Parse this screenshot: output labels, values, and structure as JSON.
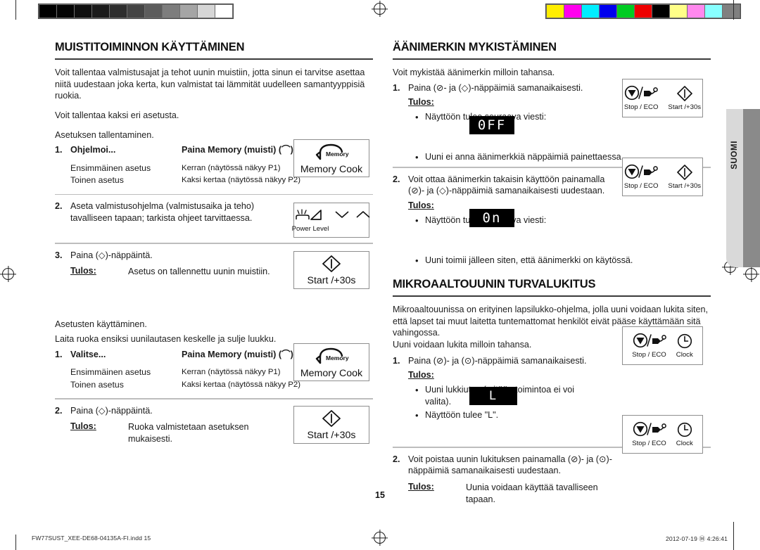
{
  "document": {
    "page_number": "15",
    "language_tab": "SUOMI",
    "footer_file": "FW77SUST_XEE-DE68-04135A-FI.indd   15",
    "footer_date": "2012-07-19   Ⓜ 4:26:41"
  },
  "calibration": {
    "grayscale_patches": [
      "#000000",
      "#050505",
      "#0f0f0f",
      "#1b1b1b",
      "#2e2e2e",
      "#444444",
      "#5c5c5c",
      "#7d7d7d",
      "#a5a5a5",
      "#d6d6d6",
      "#ffffff"
    ],
    "color_patches": [
      "#ffee00",
      "#ff00ee",
      "#00eeff",
      "#0000ee",
      "#00cc22",
      "#ee0000",
      "#000000",
      "#ffff88",
      "#ff88ee",
      "#88ffff",
      "#808080"
    ]
  },
  "left_column": {
    "title": "MUISTITOIMINNON KÄYTTÄMINEN",
    "intro_1": "Voit tallentaa valmistusajat ja tehot uunin muistiin, jotta sinun ei tarvitse asettaa niitä uudestaan joka kerta, kun valmistat tai lämmität uudelleen samantyyppisiä ruokia.",
    "intro_2": "Voit tallentaa kaksi eri asetusta.",
    "subhead_1": "Asetuksen tallentaminen.",
    "store": {
      "step1_num": "1.",
      "head_col1": "Ohjelmoi...",
      "head_col2": "Paina Memory (muisti) (⌒)-näppäintä...",
      "row1_col1": "Ensimmäinen asetus",
      "row1_col2": "Kerran (näytössä näkyy P1)",
      "row2_col1": "Toinen asetus",
      "row2_col2": "Kaksi kertaa (näytössä näkyy P2)",
      "step2_num": "2.",
      "step2_text": "Aseta valmistusohjelma (valmistusaika ja teho) tavalliseen tapaan; tarkista ohjeet tarvittaessa.",
      "step3_num": "3.",
      "step3_text": "Paina (◇)-näppäintä.",
      "step3_result_label": "Tulos:",
      "step3_result_text": "Asetus on tallennettu uunin muistiin."
    },
    "subhead_2": "Asetusten käyttäminen.",
    "use_intro": "Laita ruoka ensiksi uunilautasen keskelle ja sulje luukku.",
    "use": {
      "step1_num": "1.",
      "head_col1": "Valitse...",
      "head_col2": "Paina Memory (muisti) (⌒)-näppäintä...",
      "row1_col1": "Ensimmäinen asetus",
      "row1_col2": "Kerran (näytössä näkyy P1)",
      "row2_col1": "Toinen asetus",
      "row2_col2": "Kaksi kertaa (näytössä näkyy P2)",
      "step2_num": "2.",
      "step2_text": "Paina (◇)-näppäintä.",
      "step2_result_label": "Tulos:",
      "step2_result_text": "Ruoka valmistetaan asetuksen mukaisesti."
    }
  },
  "right_column": {
    "sound": {
      "title": "ÄÄNIMERKIN MYKISTÄMINEN",
      "intro": "Voit mykistää äänimerkin milloin tahansa.",
      "step1_num": "1.",
      "step1_text": "Paina (⊘- ja (◇)-näppäimiä samanaikaisesti.",
      "step1_result_label": "Tulos:",
      "step1_bullet1": "Näyttöön tulee seuraava viesti:",
      "step1_display": "0FF",
      "step1_bullet2": "Uuni ei anna äänimerkkiä näppäimiä painettaessa.",
      "step2_num": "2.",
      "step2_text": "Voit ottaa äänimerkin takaisin käyttöön painamalla (⊘)- ja (◇)-näppäimiä samanaikaisesti uudestaan.",
      "step2_result_label": "Tulos:",
      "step2_bullet1": "Näyttöön tulee seuraava viesti:",
      "step2_display": "0n",
      "step2_bullet2": "Uuni toimii jälleen siten, että äänimerkki on käytössä."
    },
    "lock": {
      "title": "MIKROAALTOUUNIN TURVALUKITUS",
      "intro_1": "Mikroaaltouunissa on erityinen lapsilukko-ohjelma, jolla uuni voidaan lukita siten, että lapset tai muut laitetta tuntemattomat henkilöt eivät pääse käyttämään sitä vahingossa.",
      "intro_2": "Uuni voidaan lukita milloin tahansa.",
      "step1_num": "1.",
      "step1_text": "Paina (⊘)- ja (⊙)-näppäimiä samanaikaisesti.",
      "step1_result_label": "Tulos:",
      "step1_bullet1": "Uuni lukkiutuu (mitään toimintoa ei voi valita).",
      "step1_bullet2": "Näyttöön tulee \"L\".",
      "step1_display": "L",
      "step2_num": "2.",
      "step2_text": "Voit poistaa uunin lukituksen painamalla (⊘)- ja (⊙)-näppäimiä samanaikaisesti uudestaan.",
      "step2_result_label": "Tulos:",
      "step2_result_text": "Uunia voidaan käyttää tavalliseen tapaan."
    }
  },
  "key_boxes": {
    "memory_icon_text": "Memory",
    "memory_label": "Memory Cook",
    "power_level_label": "Power Level",
    "start_label": "Start /+30s",
    "stop_eco_label": "Stop / ECO",
    "clock_label": "Clock"
  }
}
